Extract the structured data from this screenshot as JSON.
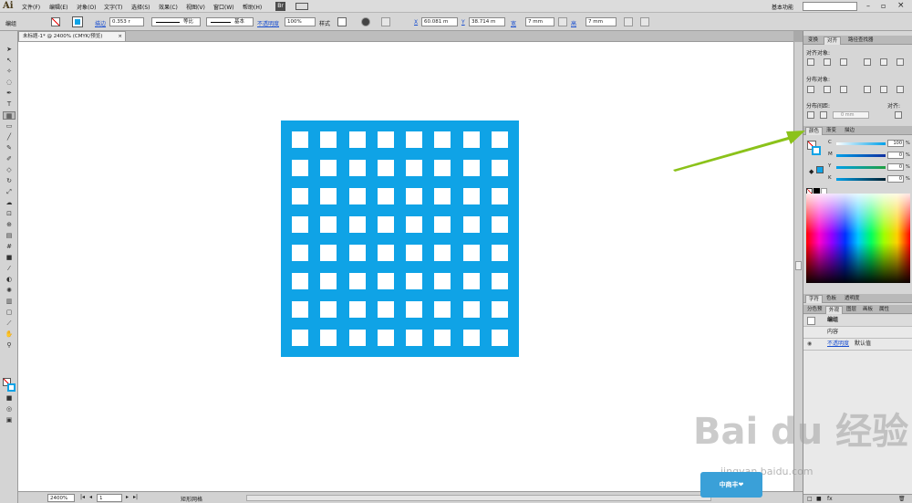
{
  "app": {
    "logo": "Ai",
    "workspace": "基本功能"
  },
  "menu": [
    "文件(F)",
    "编辑(E)",
    "对象(O)",
    "文字(T)",
    "选择(S)",
    "效果(C)",
    "视图(V)",
    "窗口(W)",
    "帮助(H)"
  ],
  "bridge_label": "Br",
  "control": {
    "selection": "编组",
    "stroke_label": "描边",
    "stroke_value": "0.353 r",
    "profile": "等比",
    "brush": "基本",
    "opacity_label": "不透明度",
    "opacity_value": "100%",
    "style_label": "样式",
    "x_label": "X",
    "x_value": "60.081 m",
    "y_label": "Y",
    "y_value": "38.714 m",
    "w_label": "宽",
    "w_value": "7 mm",
    "h_label": "高",
    "h_value": "7 mm"
  },
  "document": {
    "tab": "未标题-1* @ 2400% (CMYK/预览)",
    "close": "×"
  },
  "artwork": {
    "fill": "#0fa3e6",
    "cols": 8,
    "rows": 8
  },
  "status": {
    "zoom": "2400%",
    "page": "1",
    "info": "矩形网格"
  },
  "panels": {
    "tabs_top": [
      "变换",
      "对齐",
      "路径查找器"
    ],
    "align": {
      "objects": "对齐对象:",
      "distribute": "分布对象:",
      "spacing": "分布间距:",
      "spacing_value": "0 mm",
      "align_to": "对齐:"
    },
    "tabs_color": [
      "颜色",
      "渐变",
      "描边"
    ],
    "color": {
      "channels": [
        {
          "label": "C",
          "value": "100",
          "gradient": "linear-gradient(to right,#fff,#00a0e9)"
        },
        {
          "label": "M",
          "value": "0",
          "gradient": "linear-gradient(to right,#00a0e9,#1030a0)"
        },
        {
          "label": "Y",
          "value": "0",
          "gradient": "linear-gradient(to right,#00a0e9,#20a040)"
        },
        {
          "label": "K",
          "value": "0",
          "gradient": "linear-gradient(to right,#00a0e9,#002030)"
        }
      ],
      "unit": "%"
    },
    "tabs_char": [
      "字符",
      "色板",
      "透明度"
    ],
    "tabs_app": [
      "分色预",
      "外观",
      "图层",
      "画板",
      "属性"
    ],
    "appearance": {
      "group": "编组",
      "contents": "内容",
      "opacity_link": "不透明度",
      "opacity_value": "默认值"
    }
  },
  "watermark": {
    "main": "Bai du 经验",
    "sub": "jingyan.baidu.com",
    "badge": "中商丰❤"
  }
}
